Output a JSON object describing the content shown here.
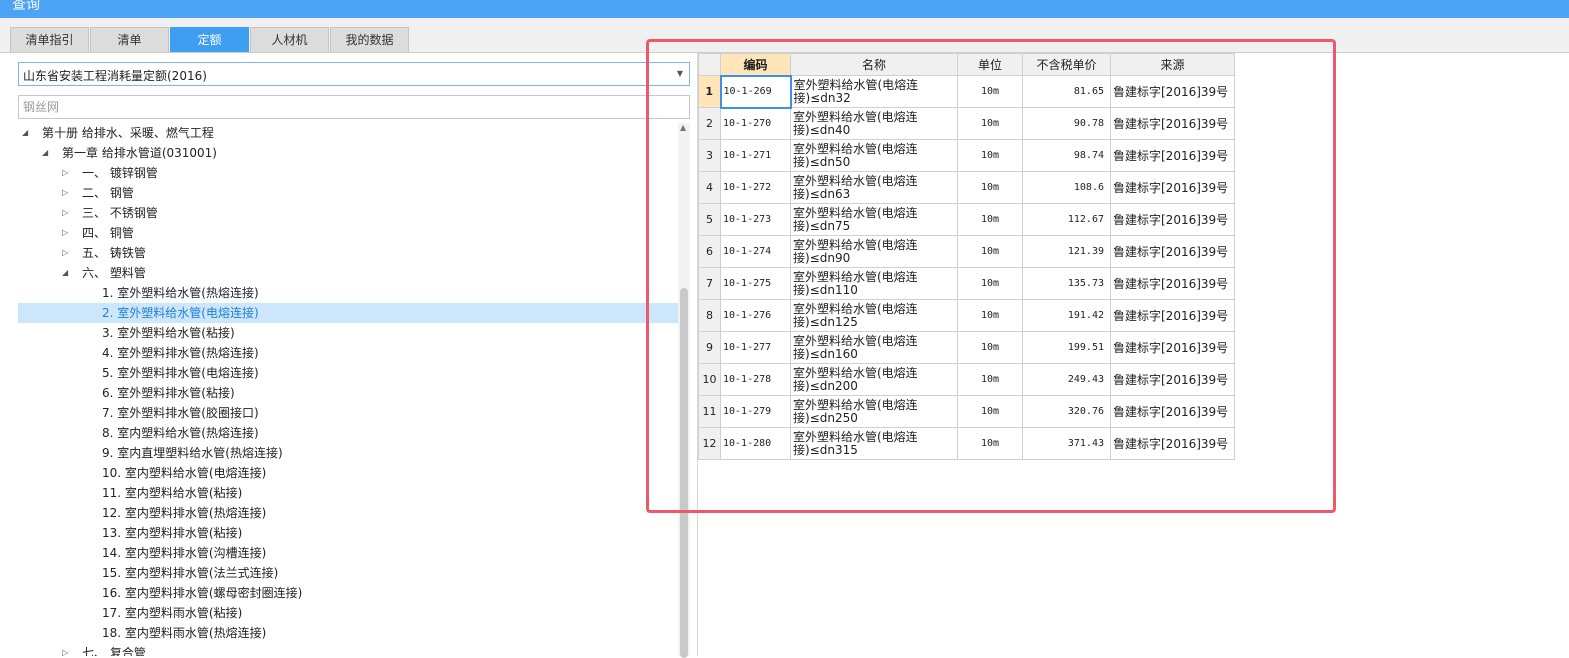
{
  "window": {
    "title": "查询"
  },
  "tabs": [
    {
      "label": "清单指引",
      "active": false
    },
    {
      "label": "清单",
      "active": false
    },
    {
      "label": "定额",
      "active": true
    },
    {
      "label": "人材机",
      "active": false
    },
    {
      "label": "我的数据",
      "active": false
    }
  ],
  "quota_select": {
    "value": "山东省安装工程消耗量定额(2016)"
  },
  "search": {
    "value": "",
    "placeholder": "钢丝网"
  },
  "tree": [
    {
      "label": "第十册 给排水、采暖、燃气工程",
      "level": 0,
      "expanded": true
    },
    {
      "label": "第一章 给排水管道(031001)",
      "level": 1,
      "expanded": true
    },
    {
      "label": "一、 镀锌钢管",
      "level": 2,
      "expanded": false
    },
    {
      "label": "二、 钢管",
      "level": 2,
      "expanded": false
    },
    {
      "label": "三、 不锈钢管",
      "level": 2,
      "expanded": false
    },
    {
      "label": "四、 铜管",
      "level": 2,
      "expanded": false
    },
    {
      "label": "五、 铸铁管",
      "level": 2,
      "expanded": false
    },
    {
      "label": "六、 塑料管",
      "level": 2,
      "expanded": true
    },
    {
      "label": "1. 室外塑料给水管(热熔连接)",
      "level": 3
    },
    {
      "label": "2. 室外塑料给水管(电熔连接)",
      "level": 3,
      "selected": true
    },
    {
      "label": "3. 室外塑料给水管(粘接)",
      "level": 3
    },
    {
      "label": "4. 室外塑料排水管(热熔连接)",
      "level": 3
    },
    {
      "label": "5. 室外塑料排水管(电熔连接)",
      "level": 3
    },
    {
      "label": "6. 室外塑料排水管(粘接)",
      "level": 3
    },
    {
      "label": "7. 室外塑料排水管(胶圈接口)",
      "level": 3
    },
    {
      "label": "8. 室内塑料给水管(热熔连接)",
      "level": 3
    },
    {
      "label": "9. 室内直埋塑料给水管(热熔连接)",
      "level": 3
    },
    {
      "label": "10. 室内塑料给水管(电熔连接)",
      "level": 3
    },
    {
      "label": "11. 室内塑料给水管(粘接)",
      "level": 3
    },
    {
      "label": "12. 室内塑料排水管(热熔连接)",
      "level": 3
    },
    {
      "label": "13. 室内塑料排水管(粘接)",
      "level": 3
    },
    {
      "label": "14. 室内塑料排水管(沟槽连接)",
      "level": 3
    },
    {
      "label": "15. 室内塑料排水管(法兰式连接)",
      "level": 3
    },
    {
      "label": "16. 室内塑料排水管(螺母密封圈连接)",
      "level": 3
    },
    {
      "label": "17. 室内塑料雨水管(粘接)",
      "level": 3
    },
    {
      "label": "18. 室内塑料雨水管(热熔连接)",
      "level": 3
    },
    {
      "label": "七、 复合管",
      "level": 2,
      "expanded": false
    }
  ],
  "table": {
    "headers": {
      "code": "编码",
      "name": "名称",
      "unit": "单位",
      "price": "不含税单价",
      "source": "来源"
    },
    "rows": [
      {
        "no": "1",
        "code": "10-1-269",
        "name": "室外塑料给水管(电熔连接)≤dn32",
        "unit": "10m",
        "price": "81.65",
        "source": "鲁建标字[2016]39号"
      },
      {
        "no": "2",
        "code": "10-1-270",
        "name": "室外塑料给水管(电熔连接)≤dn40",
        "unit": "10m",
        "price": "90.78",
        "source": "鲁建标字[2016]39号"
      },
      {
        "no": "3",
        "code": "10-1-271",
        "name": "室外塑料给水管(电熔连接)≤dn50",
        "unit": "10m",
        "price": "98.74",
        "source": "鲁建标字[2016]39号"
      },
      {
        "no": "4",
        "code": "10-1-272",
        "name": "室外塑料给水管(电熔连接)≤dn63",
        "unit": "10m",
        "price": "108.6",
        "source": "鲁建标字[2016]39号"
      },
      {
        "no": "5",
        "code": "10-1-273",
        "name": "室外塑料给水管(电熔连接)≤dn75",
        "unit": "10m",
        "price": "112.67",
        "source": "鲁建标字[2016]39号"
      },
      {
        "no": "6",
        "code": "10-1-274",
        "name": "室外塑料给水管(电熔连接)≤dn90",
        "unit": "10m",
        "price": "121.39",
        "source": "鲁建标字[2016]39号"
      },
      {
        "no": "7",
        "code": "10-1-275",
        "name": "室外塑料给水管(电熔连接)≤dn110",
        "unit": "10m",
        "price": "135.73",
        "source": "鲁建标字[2016]39号"
      },
      {
        "no": "8",
        "code": "10-1-276",
        "name": "室外塑料给水管(电熔连接)≤dn125",
        "unit": "10m",
        "price": "191.42",
        "source": "鲁建标字[2016]39号"
      },
      {
        "no": "9",
        "code": "10-1-277",
        "name": "室外塑料给水管(电熔连接)≤dn160",
        "unit": "10m",
        "price": "199.51",
        "source": "鲁建标字[2016]39号"
      },
      {
        "no": "10",
        "code": "10-1-278",
        "name": "室外塑料给水管(电熔连接)≤dn200",
        "unit": "10m",
        "price": "249.43",
        "source": "鲁建标字[2016]39号"
      },
      {
        "no": "11",
        "code": "10-1-279",
        "name": "室外塑料给水管(电熔连接)≤dn250",
        "unit": "10m",
        "price": "320.76",
        "source": "鲁建标字[2016]39号"
      },
      {
        "no": "12",
        "code": "10-1-280",
        "name": "室外塑料给水管(电熔连接)≤dn315",
        "unit": "10m",
        "price": "371.43",
        "source": "鲁建标字[2016]39号"
      }
    ]
  },
  "icons": {
    "dropdown": "chevron-down-icon",
    "tree_expanded": "triangle-expanded-icon",
    "tree_collapsed": "triangle-collapsed-icon",
    "scroll_up": "scroll-up-arrow-icon"
  },
  "colors": {
    "title_bar": "#4da3f5",
    "active_tab": "#3e9ef2",
    "selected_row": "#cce6fb",
    "highlight_header": "#ffe5b8",
    "annotation_border": "#ec5a6a"
  }
}
